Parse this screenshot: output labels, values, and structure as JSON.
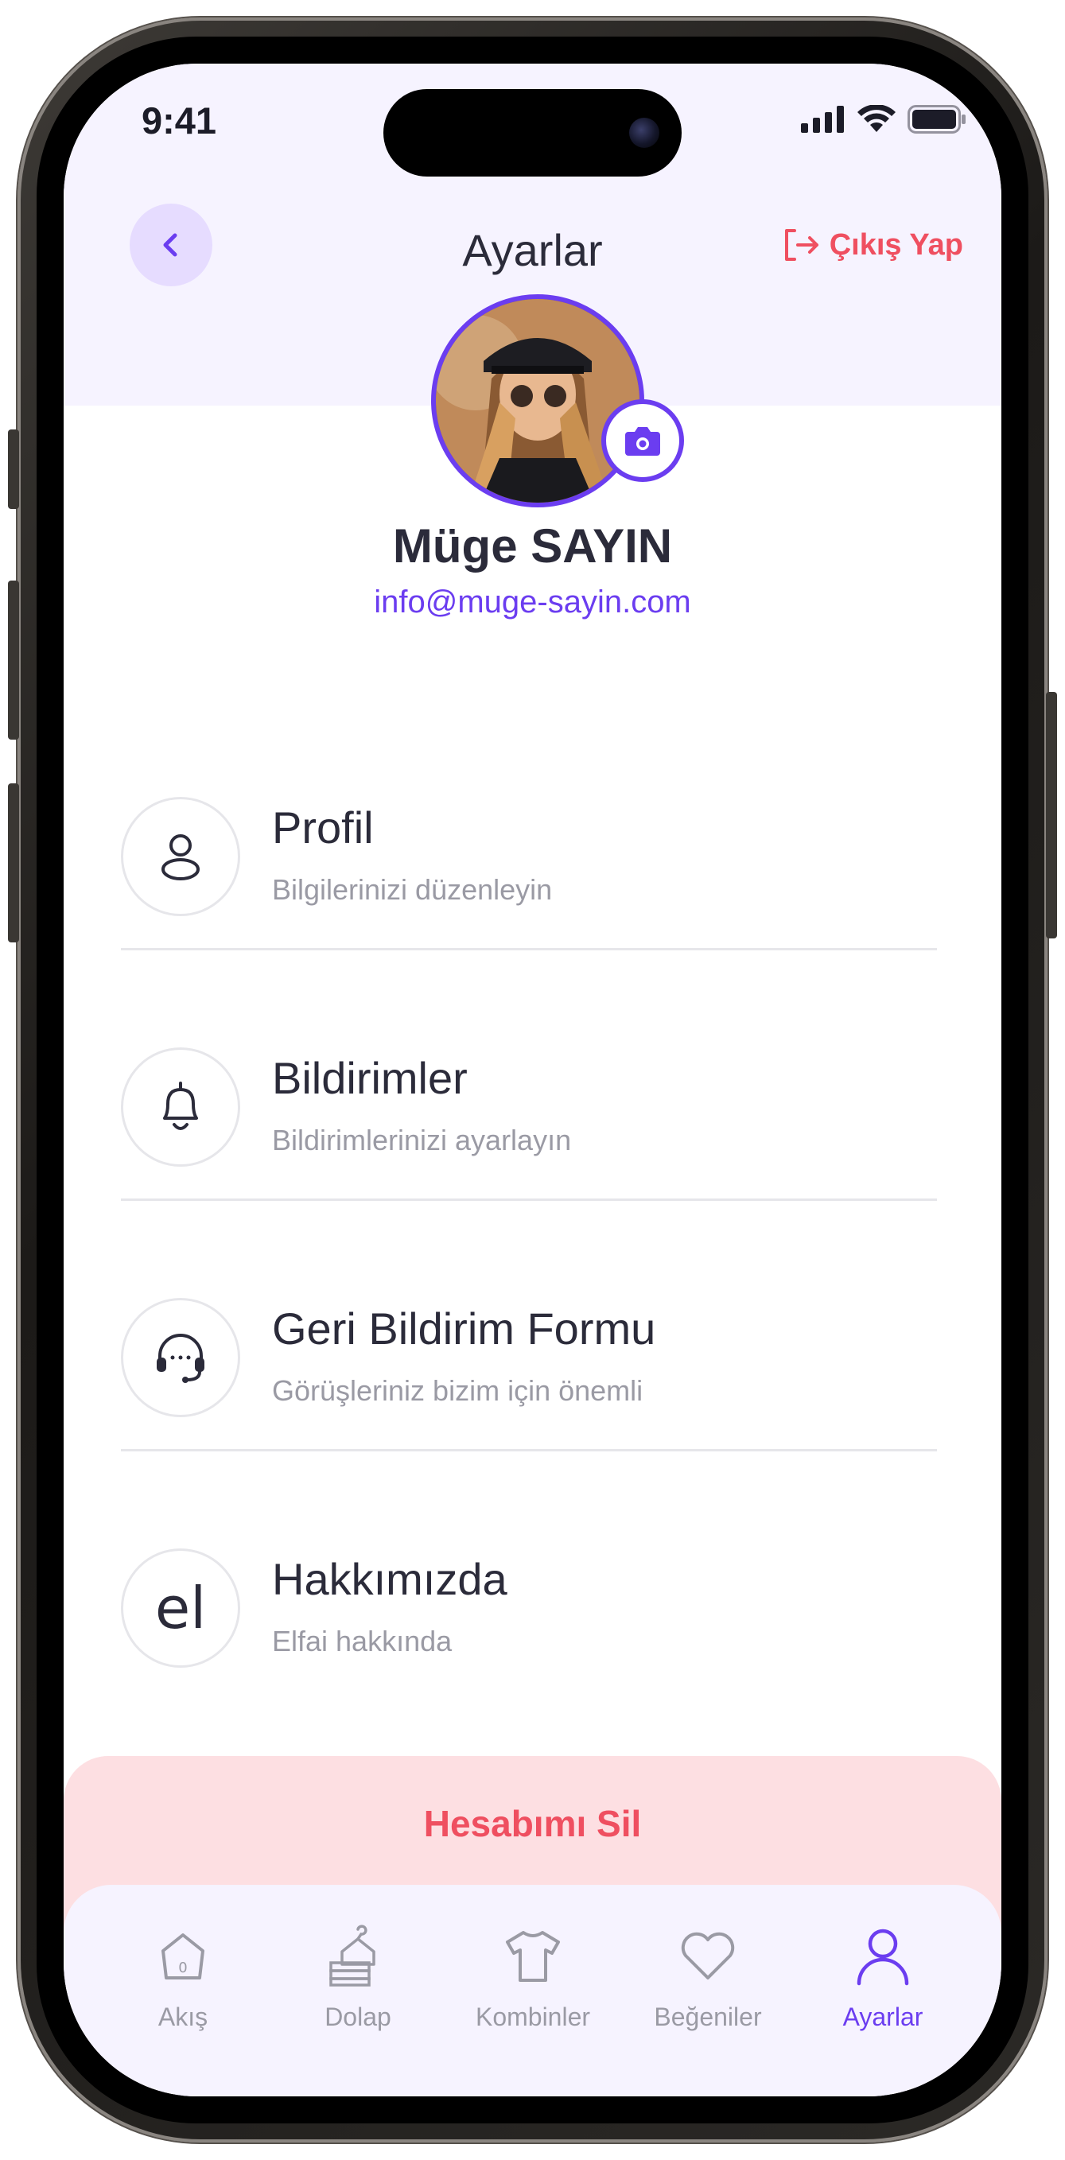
{
  "status_bar": {
    "time": "9:41"
  },
  "header": {
    "title": "Ayarlar",
    "logout_label": "Çıkış Yap"
  },
  "profile": {
    "name": "Müge SAYIN",
    "email": "info@muge-sayin.com"
  },
  "menu": [
    {
      "title": "Profil",
      "subtitle": "Bilgilerinizi düzenleyin",
      "icon": "user-icon"
    },
    {
      "title": "Bildirimler",
      "subtitle": "Bildirimlerinizi ayarlayın",
      "icon": "bell-icon"
    },
    {
      "title": "Geri Bildirim Formu",
      "subtitle": "Görüşleriniz bizim için önemli",
      "icon": "headset-icon"
    },
    {
      "title": "Hakkımızda",
      "subtitle": "Elfai hakkında",
      "icon_text": "el"
    }
  ],
  "delete_account_label": "Hesabımı Sil",
  "tabs": [
    {
      "label": "Akış",
      "icon": "home-icon",
      "active": false
    },
    {
      "label": "Dolap",
      "icon": "wardrobe-icon",
      "active": false
    },
    {
      "label": "Kombinler",
      "icon": "tshirt-icon",
      "active": false
    },
    {
      "label": "Beğeniler",
      "icon": "heart-icon",
      "active": false
    },
    {
      "label": "Ayarlar",
      "icon": "user-icon",
      "active": true
    }
  ],
  "colors": {
    "accent": "#6b3df0",
    "danger": "#ef4f60",
    "header_bg": "#f6f3ff",
    "danger_bg": "#fddfe2"
  }
}
